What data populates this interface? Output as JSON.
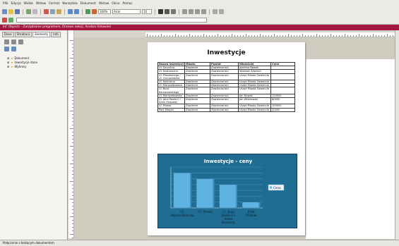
{
  "menubar": {
    "items": [
      "Plik",
      "Edycja",
      "Widok",
      "Wstaw",
      "Format",
      "Narzędzia",
      "Dokument",
      "Wstaw",
      "Okno",
      "Pomoc"
    ]
  },
  "toolbar": {
    "font_name": "Arial",
    "font_size": "10",
    "zoom": "100%"
  },
  "infobar": {
    "text": "Inf. Objects - Zarządzanie programem, Drzewo sekcji, Analiza Ustawień"
  },
  "sidepanel": {
    "tabs": [
      "Dane",
      "Struktura",
      "Elementy",
      "Info"
    ],
    "tree": [
      "Dokument",
      "Inwestycje dane",
      "Wykresy"
    ]
  },
  "document": {
    "title": "Inwestycje",
    "table": {
      "headers": [
        "Nazwa inwestycji",
        "Miasto",
        "Powiat",
        "Właściciel",
        "Cena"
      ],
      "rows": [
        [
          "Ul. Szczytna",
          "Zawiercie",
          "Zawierciański",
          "Józefina Nowak",
          ""
        ],
        [
          "Ul. Nadrzeczna",
          "Zawiercie",
          "Zawierciański",
          "Wiesław Zawierci",
          ""
        ],
        [
          "Ul. Pilsudskiego / Ul. Grunwaldzka",
          "Zawiercie",
          "Zawierciański",
          "Urząd Miasta Zawiercie",
          ""
        ],
        [
          "Ul. Kościelna",
          "Zawiercie",
          "Zawierciański",
          "Urząd Miasta Zawiercie",
          ""
        ],
        [
          "Ul. Marszałkowska",
          "Zawiercie",
          "Zawierciański",
          "Urząd Miasta Zawiercie",
          ""
        ],
        [
          "Ul. Bora Komorowskiego",
          "Zawiercie",
          "Zawierciański",
          "Urząd Miasta Zawiercie",
          ""
        ],
        [
          "Ul. Marszałkowska",
          "Zawiercie",
          "Zawierciański",
          "Jan Nowak",
          "120000"
        ],
        [
          "Ul. Jana Pawła II i Armii Krajowej",
          "Zawiercie",
          "Zawierciański",
          "Jan Wiśniewski",
          "80000"
        ],
        [
          "Ul. Prosta",
          "Zawiercie",
          "Zawierciański",
          "Urząd Miasta Zawiercie",
          "100000"
        ],
        [
          "Park Miejski",
          "Zawiercie",
          "Zawierciański",
          "Urząd Miasta Zawiercie",
          "20000"
        ]
      ]
    }
  },
  "chart_data": {
    "type": "bar",
    "title": "Inwestycje - ceny",
    "categories": [
      "Ul. Marszałkowska",
      "Ul. Prosta",
      "Ul. Jana Pawła II i Armii Krajowej",
      "Park Miejski"
    ],
    "series": [
      {
        "name": "Cena",
        "values": [
          120000,
          100000,
          80000,
          20000
        ]
      }
    ],
    "ylim": [
      0,
      140000
    ],
    "grid": true,
    "legend": "right",
    "colors": {
      "bar": "#5eb3e0",
      "bar_side": "#3d8fbd",
      "background": "#1f6d92"
    }
  },
  "statusbar": {
    "text": "Połączenie z bieżącym dokumentem"
  }
}
